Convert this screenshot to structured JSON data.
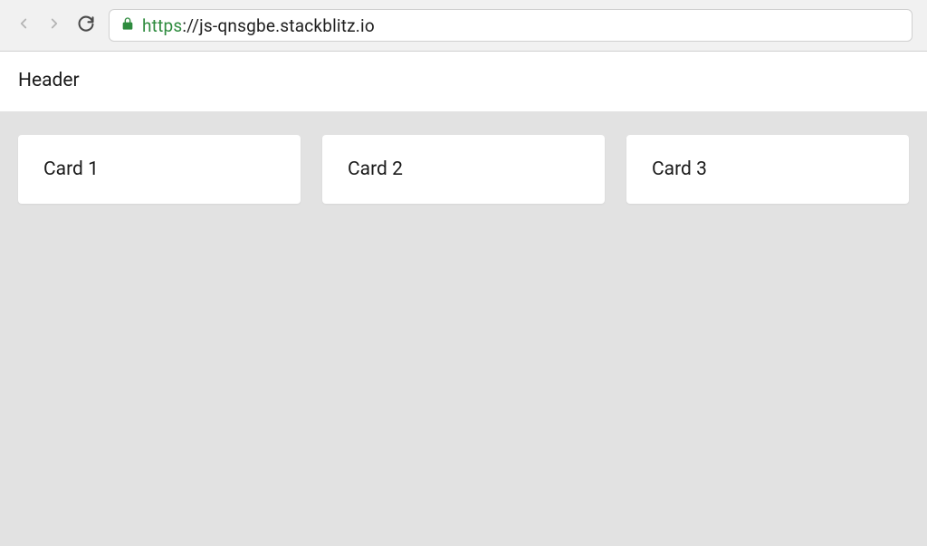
{
  "browser": {
    "url_scheme": "https",
    "url_rest": "://js-qnsgbe.stackblitz.io"
  },
  "page": {
    "header_title": "Header",
    "cards": [
      {
        "title": "Card 1"
      },
      {
        "title": "Card 2"
      },
      {
        "title": "Card 3"
      }
    ]
  }
}
